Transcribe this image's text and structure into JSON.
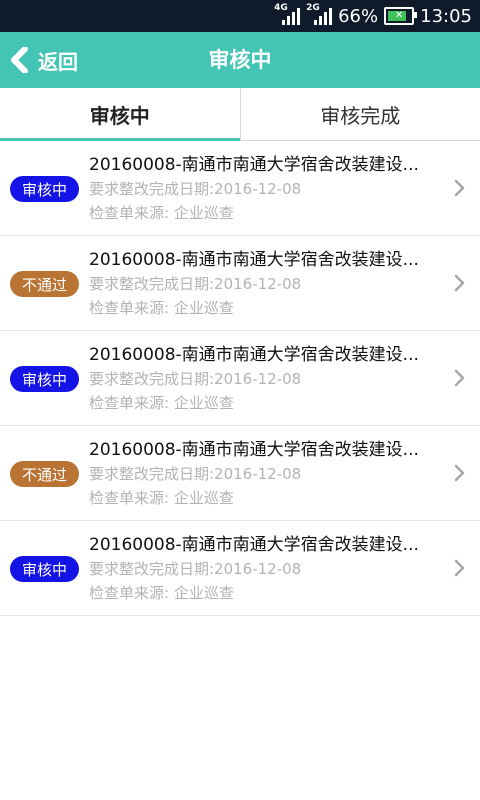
{
  "status_bar": {
    "network_1": "4G",
    "network_2": "2G",
    "battery": "66%",
    "time": "13:05"
  },
  "header": {
    "back_label": "返回",
    "title": "审核中"
  },
  "tabs": [
    {
      "label": "审核中",
      "active": true
    },
    {
      "label": "审核完成",
      "active": false
    }
  ],
  "items": [
    {
      "status": "审核中",
      "status_type": "reviewing",
      "title": "20160008-南通市南通大学宿舍改装建设...",
      "due": "要求整改完成日期:2016-12-08",
      "source": "检查单来源:  企业巡查"
    },
    {
      "status": "不通过",
      "status_type": "rejected",
      "title": "20160008-南通市南通大学宿舍改装建设...",
      "due": "要求整改完成日期:2016-12-08",
      "source": "检查单来源:  企业巡查"
    },
    {
      "status": "审核中",
      "status_type": "reviewing",
      "title": "20160008-南通市南通大学宿舍改装建设...",
      "due": "要求整改完成日期:2016-12-08",
      "source": "检查单来源:  企业巡查"
    },
    {
      "status": "不通过",
      "status_type": "rejected",
      "title": "20160008-南通市南通大学宿舍改装建设...",
      "due": "要求整改完成日期:2016-12-08",
      "source": "检查单来源:  企业巡查"
    },
    {
      "status": "审核中",
      "status_type": "reviewing",
      "title": "20160008-南通市南通大学宿舍改装建设...",
      "due": "要求整改完成日期:2016-12-08",
      "source": "检查单来源:  企业巡查"
    }
  ],
  "colors": {
    "accent": "#44c4b4",
    "reviewing": "#1414e6",
    "rejected": "#b97434"
  }
}
